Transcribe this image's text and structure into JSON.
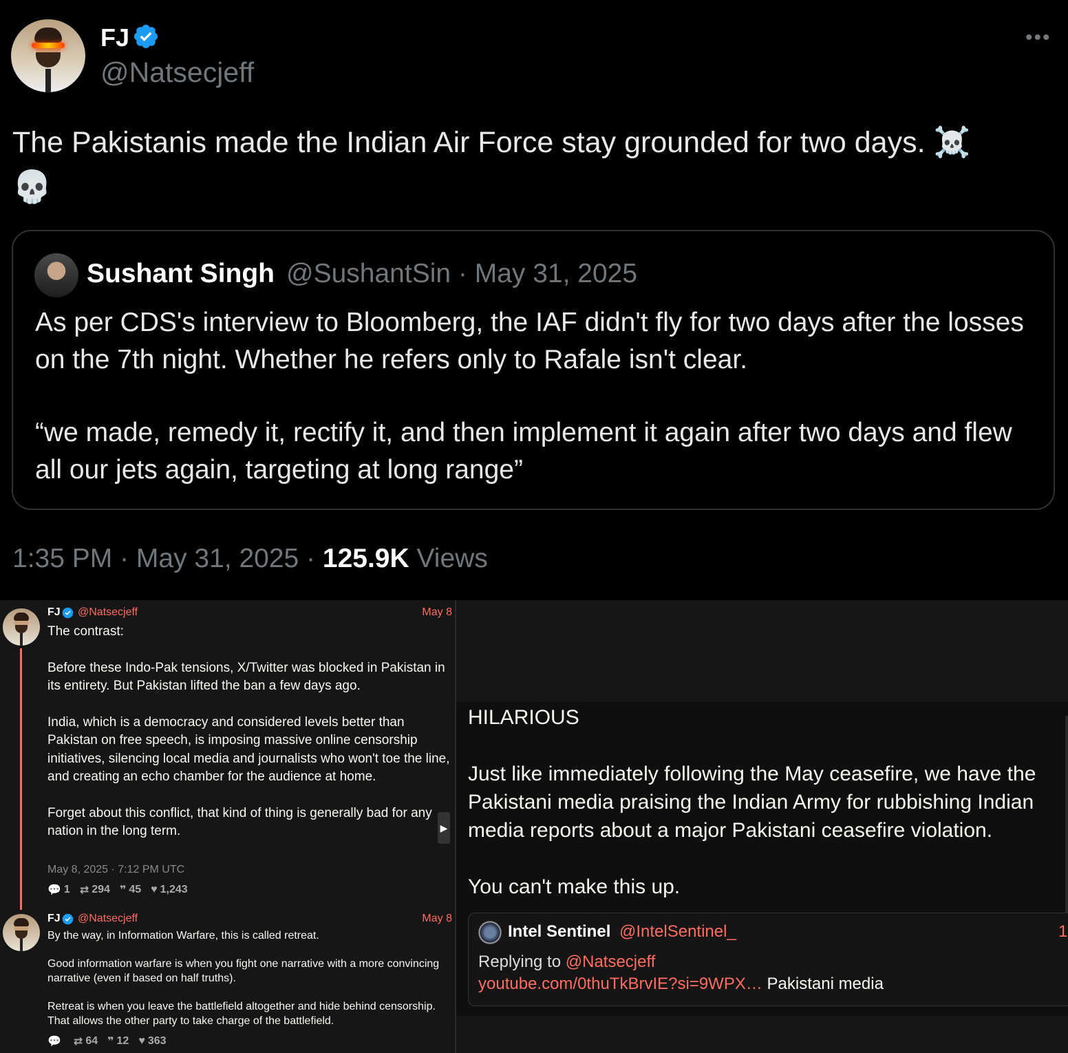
{
  "top_tweet": {
    "author_name": "FJ",
    "author_handle": "@Natsecjeff",
    "text": "The Pakistanis made the Indian Air Force stay grounded for two days. ☠️",
    "emoji_line": "💀",
    "quoted": {
      "author_name": "Sushant Singh",
      "meta": "@SushantSin · May 31, 2025",
      "text_p1": "As per CDS's interview to Bloomberg, the IAF didn't fly for two days after the losses on the 7th night. Whether he refers only to Rafale isn't clear.",
      "text_p2": "“we made, remedy it, rectify it, and then implement it again after two days and flew all our jets again, targeting at long range”"
    },
    "timestamp": "1:35 PM · May 31, 2025 · ",
    "views_count": "125.9K",
    "views_label": " Views",
    "more_icon": "more-horizontal-icon",
    "verified_icon": "verified-badge-icon",
    "verified_color": "#1d9bf0"
  },
  "thread": [
    {
      "author_name": "FJ",
      "author_handle": "@Natsecjeff",
      "date": "May 8",
      "body": "The contrast:\n\nBefore these Indo-Pak tensions, X/Twitter was blocked in Pakistan in its entirety. But Pakistan lifted the ban a few days ago.\n\nIndia, which is a democracy and considered levels better than Pakistan on free speech, is imposing massive online censorship initiatives, silencing local media and journalists who won't toe the line, and creating an echo chamber for the audience at home.\n\nForget about this conflict, that kind of thing is generally bad for any nation in the long term.",
      "full_timestamp": "May 8, 2025 · 7:12 PM UTC",
      "replies": "1",
      "retweets": "294",
      "quotes": "45",
      "likes": "1,243"
    },
    {
      "author_name": "FJ",
      "author_handle": "@Natsecjeff",
      "date": "May 8",
      "body": "By the way, in Information Warfare, this is called retreat.\n\nGood information warfare is when you fight one narrative with a more convincing narrative (even if based on half truths).\n\nRetreat is when you leave the battlefield altogether and hide behind censorship. That allows the other party to take charge of the battlefield.",
      "replies": "",
      "retweets": "64",
      "quotes": "12",
      "likes": "363"
    }
  ],
  "right_panel": {
    "text": "HILARIOUS\n\nJust like immediately following the May ceasefire, we have the Pakistani media praising the Indian Army for rubbishing Indian media reports about a major Pakistani ceasefire violation.\n\nYou can't make this up.",
    "inner": {
      "author_name": "Intel Sentinel",
      "author_handle": "@IntelSentinel_",
      "trailing": "1",
      "reply_prefix": "Replying to ",
      "reply_handle": "@Natsecjeff",
      "link": "youtube.com/0thuTkBrvIE?si=9WPX…",
      "link_suffix": " Pakistani media"
    }
  },
  "colors": {
    "accent_link": "#ff6c60",
    "twitter_blue": "#1d9bf0",
    "muted": "#71767b"
  }
}
